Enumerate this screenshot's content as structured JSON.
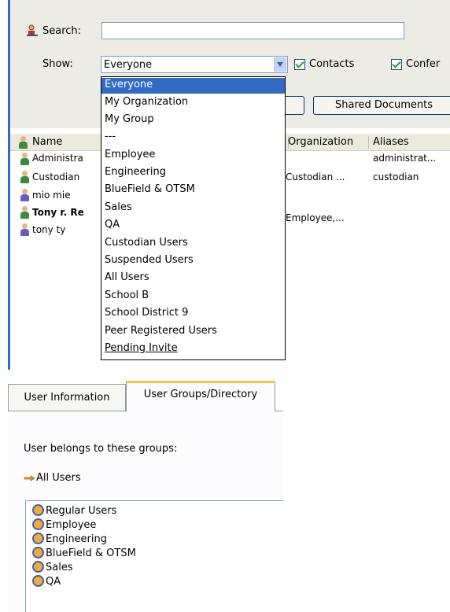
{
  "filter": {
    "search_label": "Search:",
    "search_value": "",
    "show_label": "Show:",
    "show_value": "Everyone",
    "contacts_label": "Contacts",
    "contacts_checked": true,
    "conferences_label": "Confer",
    "conferences_checked": true
  },
  "toolbar": {
    "shared_documents_label": "Shared Documents"
  },
  "show_options": [
    "Everyone",
    "My Organization",
    "My Group",
    "---",
    "Employee",
    "Engineering",
    "BlueField & OTSM",
    "Sales",
    "QA",
    "Custodian Users",
    "Suspended Users",
    "All Users",
    "School B",
    "School District 9",
    "Peer Registered Users",
    "Pending Invite"
  ],
  "user_list": {
    "columns": [
      "Name",
      "Organization",
      "Aliases"
    ],
    "rows": [
      {
        "name": "Administra",
        "organization": "",
        "aliases": "administrat...",
        "bold": false,
        "icon_color": "#3c8a3c"
      },
      {
        "name": "Custodian",
        "organization": "Custodian ...",
        "aliases": "custodian",
        "bold": false,
        "icon_color": "#3c8a3c"
      },
      {
        "name": "mio mie",
        "organization": "",
        "aliases": "",
        "bold": false,
        "icon_color": "#6a5ac8"
      },
      {
        "name": "Tony r. Re",
        "organization": "Employee,...",
        "aliases": "",
        "bold": true,
        "icon_color": "#3c8a3c"
      },
      {
        "name": "tony ty",
        "organization": "",
        "aliases": "",
        "bold": false,
        "icon_color": "#6a5ac8"
      }
    ]
  },
  "tabs": [
    {
      "label": "User Information",
      "active": false
    },
    {
      "label": "User Groups/Directory",
      "active": true
    }
  ],
  "groups_panel": {
    "heading": "User belongs to these groups:",
    "primary_group": "All Users",
    "groups": [
      "Regular Users",
      "Employee",
      "Engineering",
      "BlueField & OTSM",
      "Sales",
      "QA"
    ]
  },
  "colors": {
    "selection": "#316ac5",
    "accent_rule": "#2f6ad0",
    "tab_highlight": "#ffc83c"
  },
  "icons": {
    "search": "person-search-icon",
    "group": "group-icon",
    "hand": "hand-icon"
  }
}
